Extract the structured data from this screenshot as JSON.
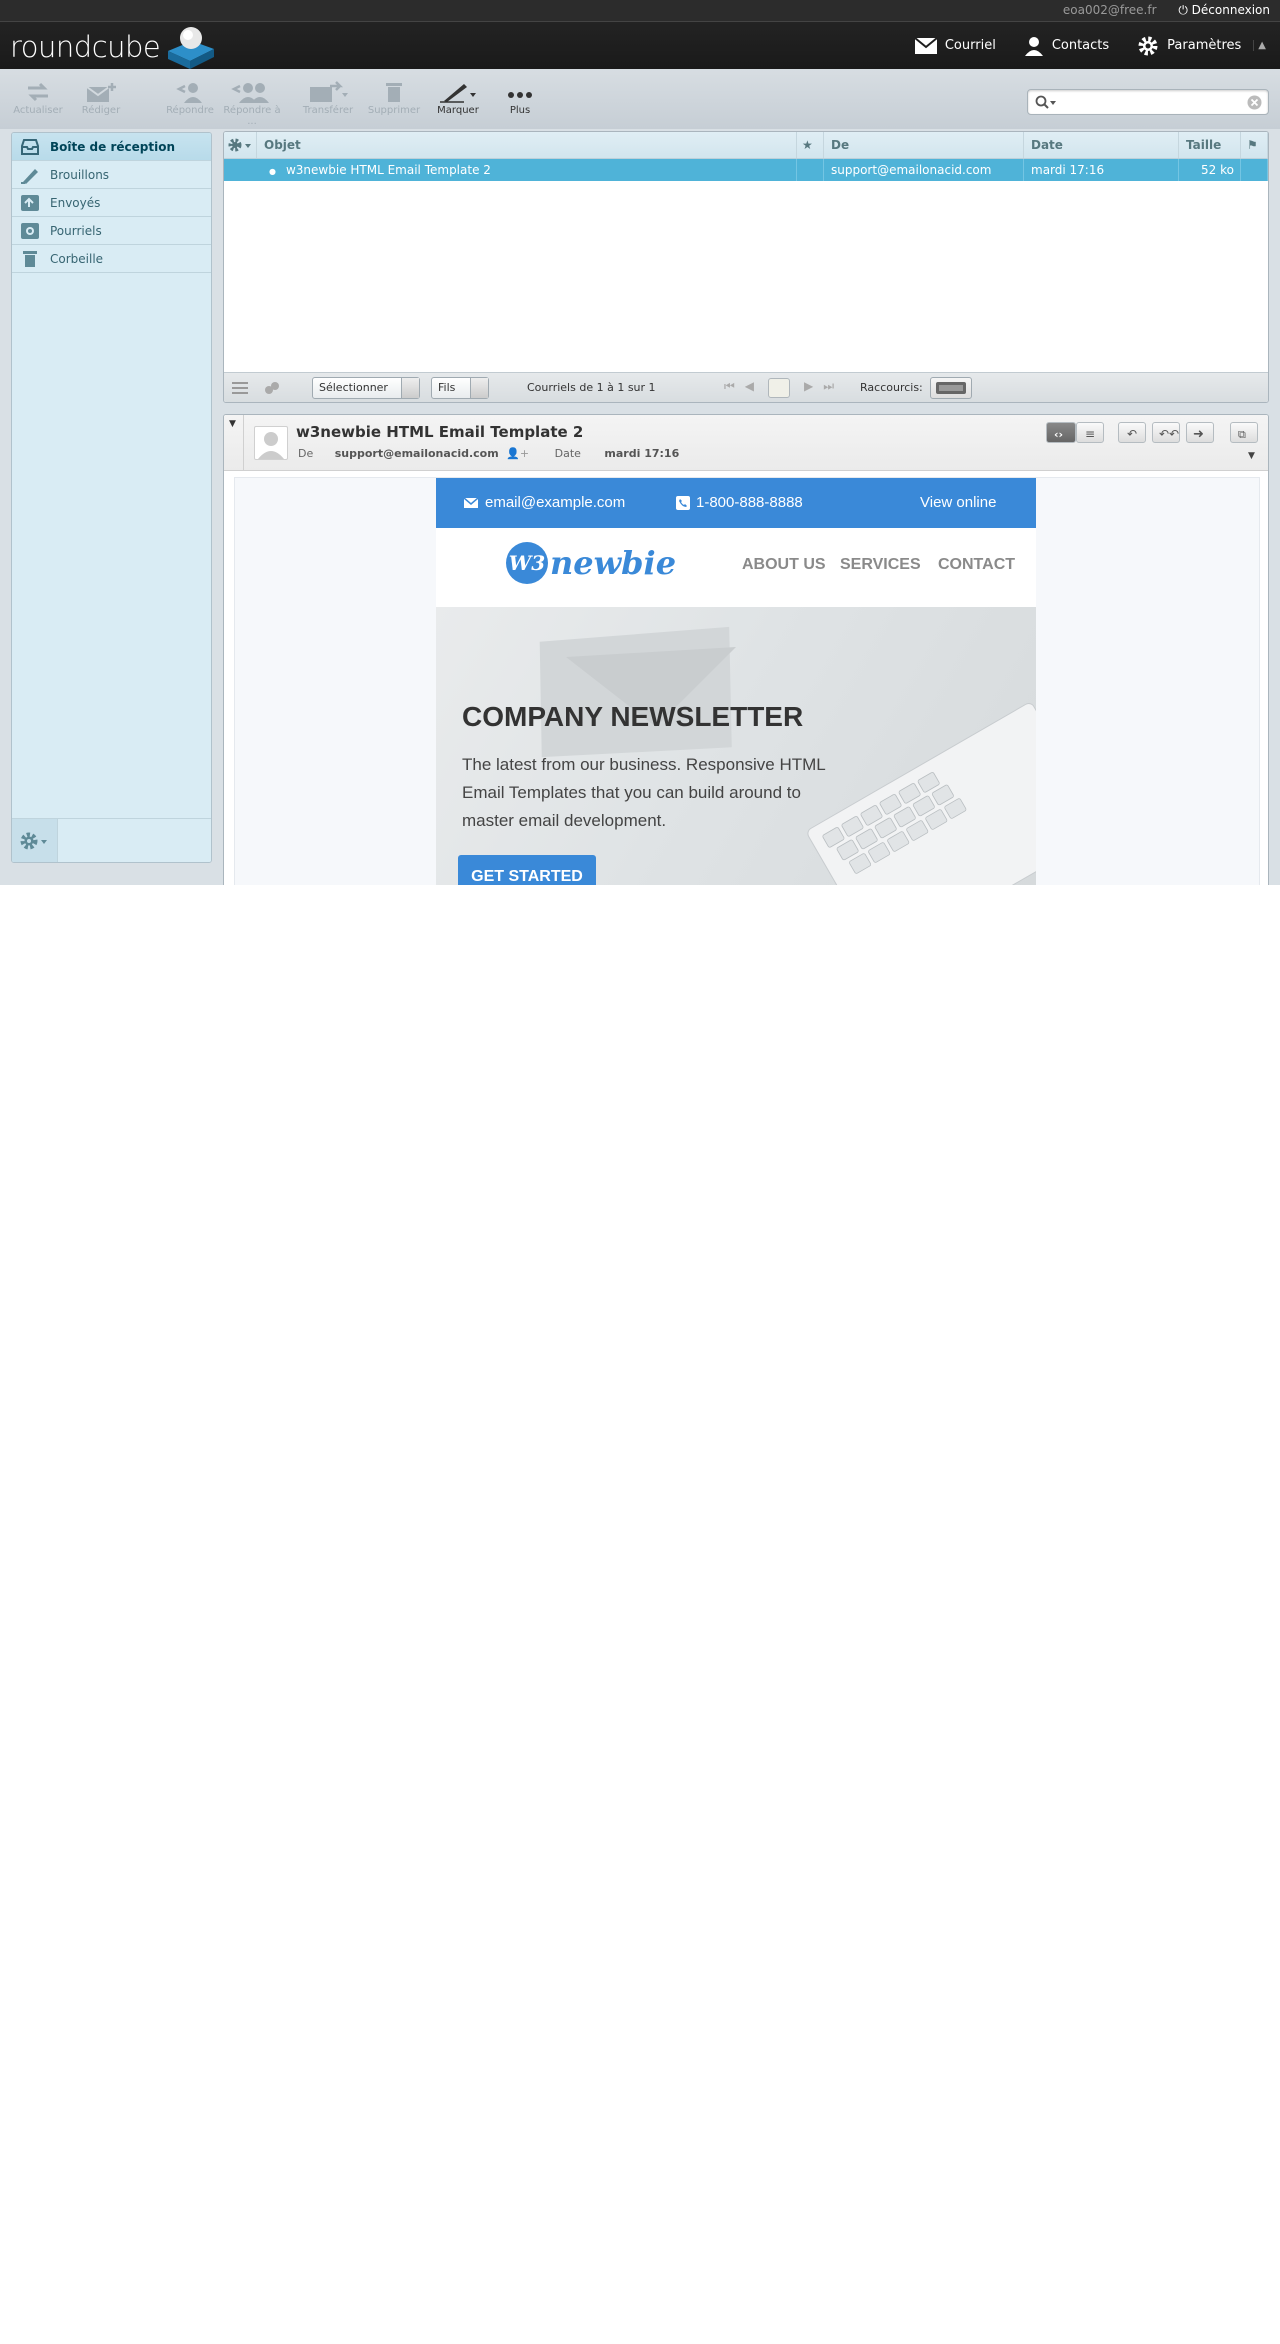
{
  "topline": {
    "user": "eoa002@free.fr",
    "logout": "Déconnexion"
  },
  "header": {
    "logo_text": "roundcube",
    "nav": [
      "Courriel",
      "Contacts",
      "Paramètres"
    ]
  },
  "toolbar": {
    "refresh": "Actualiser",
    "compose": "Rédiger",
    "reply": "Répondre",
    "reply_all": "Répondre à ...",
    "forward": "Transférer",
    "delete": "Supprimer",
    "mark": "Marquer",
    "more": "Plus"
  },
  "search": {
    "placeholder": ""
  },
  "folders": [
    {
      "label": "Boîte de réception",
      "icon": "inbox-icon"
    },
    {
      "label": "Brouillons",
      "icon": "pencil-icon"
    },
    {
      "label": "Envoyés",
      "icon": "sent-icon"
    },
    {
      "label": "Pourriels",
      "icon": "junk-icon"
    },
    {
      "label": "Corbeille",
      "icon": "trash-icon"
    }
  ],
  "messagelist": {
    "columns": [
      "Objet",
      "De",
      "Date",
      "Taille"
    ],
    "rows": [
      {
        "subject": "w3newbie HTML Email Template 2",
        "from": "support@emailonacid.com",
        "date": "mardi 17:16",
        "size": "52 ko"
      }
    ],
    "footer": {
      "select": "Sélectionner",
      "threads": "Fils",
      "count": "Courriels de 1 à 1 sur 1",
      "shortcuts": "Raccourcis:"
    }
  },
  "preview": {
    "subject": "w3newbie HTML Email Template 2",
    "from_label": "De",
    "from": "support@emailonacid.com",
    "date_label": "Date",
    "date": "mardi 17:16"
  },
  "email": {
    "contact_email": "email@example.com",
    "phone": "1-800-888-8888",
    "view_online": "View online",
    "logo_mark": "W3",
    "logo_text": "newbie",
    "nav": [
      "ABOUT US",
      "SERVICES",
      "CONTACT"
    ],
    "hero_title": "COMPANY NEWSLETTER",
    "hero_text": "The latest from our business. Responsive HTML Email Templates that you can build around to master email development.",
    "cta": "GET STARTED"
  },
  "colors": {
    "accent": "#3a89d8",
    "selection": "#4fb3d8",
    "header": "#1e1e1e"
  }
}
